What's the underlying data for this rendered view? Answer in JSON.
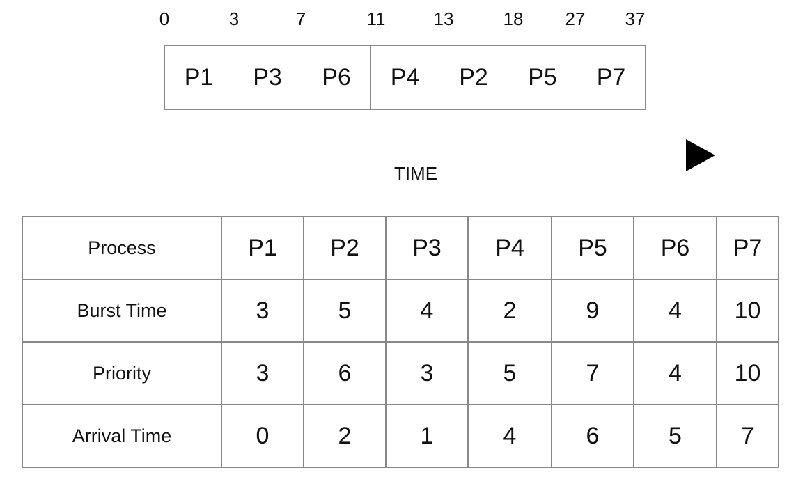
{
  "gantt": {
    "ticks": [
      "0",
      "3",
      "7",
      "11",
      "13",
      "18",
      "27",
      "37"
    ],
    "blocks": [
      "P1",
      "P3",
      "P6",
      "P4",
      "P2",
      "P5",
      "P7"
    ],
    "axis_label": "TIME"
  },
  "table": {
    "rows": [
      {
        "label": "Process",
        "values": [
          "P1",
          "P2",
          "P3",
          "P4",
          "P5",
          "P6",
          "P7"
        ]
      },
      {
        "label": "Burst Time",
        "values": [
          "3",
          "5",
          "4",
          "2",
          "9",
          "4",
          "10"
        ]
      },
      {
        "label": "Priority",
        "values": [
          "3",
          "6",
          "3",
          "5",
          "7",
          "4",
          "10"
        ]
      },
      {
        "label": "Arrival Time",
        "values": [
          "0",
          "2",
          "1",
          "4",
          "6",
          "5",
          "7"
        ]
      }
    ]
  }
}
